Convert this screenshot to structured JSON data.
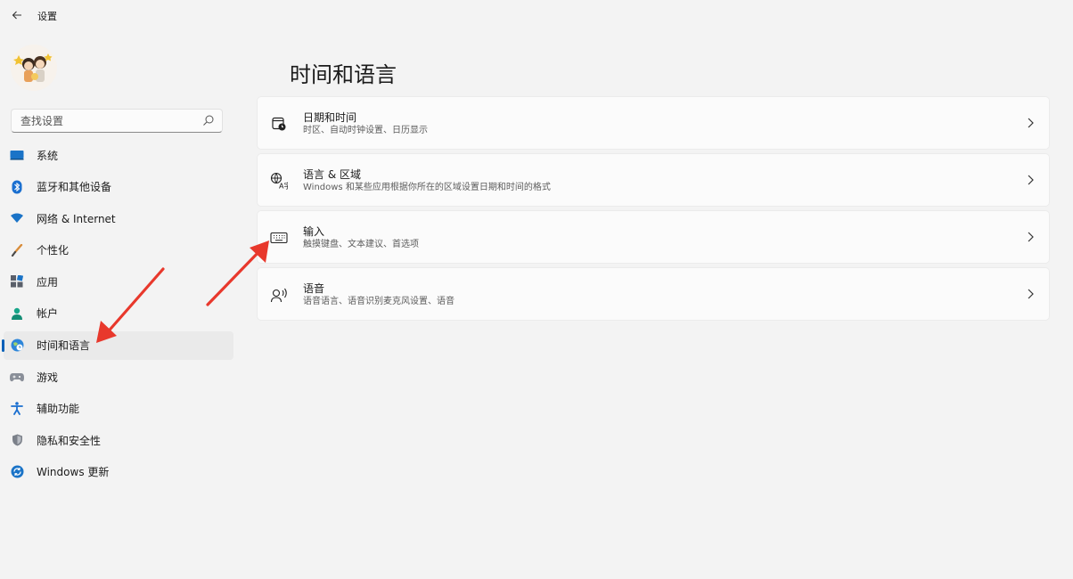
{
  "window": {
    "title": "设置"
  },
  "search": {
    "placeholder": "查找设置"
  },
  "sidebar": {
    "items": [
      {
        "label": "系统",
        "icon": "monitor-icon"
      },
      {
        "label": "蓝牙和其他设备",
        "icon": "bluetooth-icon"
      },
      {
        "label": "网络 & Internet",
        "icon": "wifi-icon"
      },
      {
        "label": "个性化",
        "icon": "brush-icon"
      },
      {
        "label": "应用",
        "icon": "apps-icon"
      },
      {
        "label": "帐户",
        "icon": "person-icon"
      },
      {
        "label": "时间和语言",
        "icon": "globe-clock-icon",
        "active": true
      },
      {
        "label": "游戏",
        "icon": "gamepad-icon"
      },
      {
        "label": "辅助功能",
        "icon": "accessibility-icon"
      },
      {
        "label": "隐私和安全性",
        "icon": "shield-icon"
      },
      {
        "label": "Windows 更新",
        "icon": "update-icon"
      }
    ]
  },
  "main": {
    "title": "时间和语言",
    "cards": [
      {
        "title": "日期和时间",
        "subtitle": "时区、自动时钟设置、日历显示",
        "icon": "calendar-clock-icon"
      },
      {
        "title": "语言 & 区域",
        "subtitle": "Windows 和某些应用根据你所在的区域设置日期和时间的格式",
        "icon": "language-icon"
      },
      {
        "title": "输入",
        "subtitle": "触摸键盘、文本建议、首选项",
        "icon": "keyboard-icon"
      },
      {
        "title": "语音",
        "subtitle": "语音语言、语音识别麦克风设置、语音",
        "icon": "speech-icon"
      }
    ]
  },
  "colors": {
    "accent": "#005fb8",
    "annotation_arrow": "#e8382c"
  }
}
